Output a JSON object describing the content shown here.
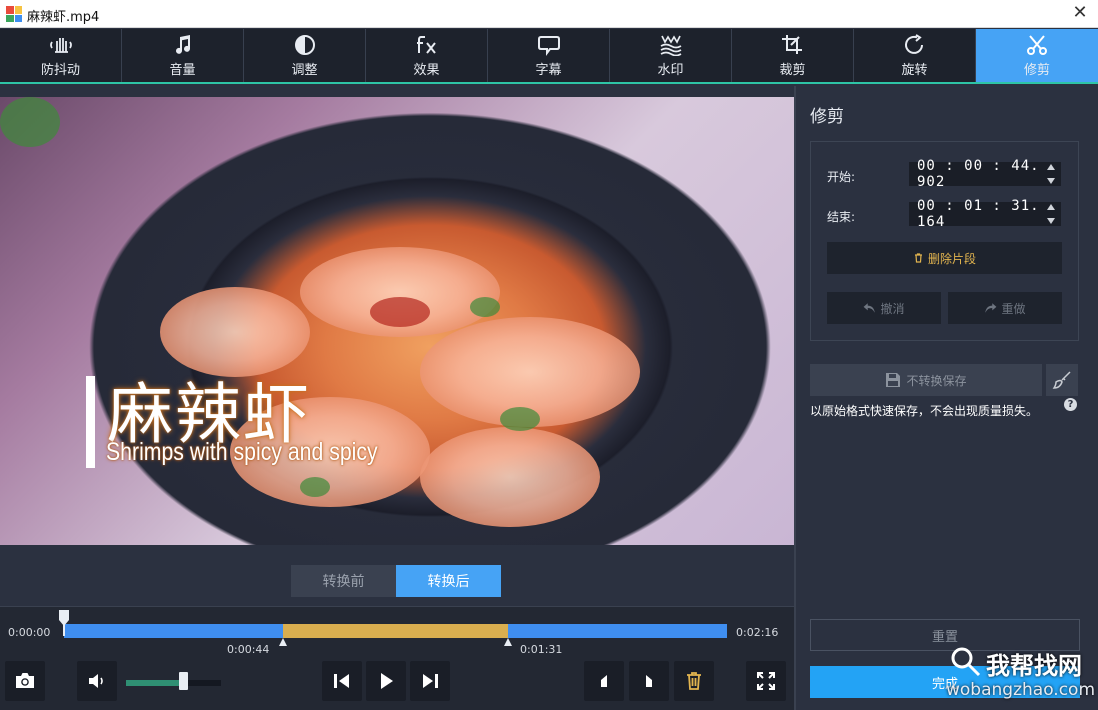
{
  "window": {
    "title": "麻辣虾.mp4",
    "close_glyph": "✕"
  },
  "toolbar": {
    "tools": [
      {
        "label": "防抖动",
        "icon": "hand-stabilize-icon"
      },
      {
        "label": "音量",
        "icon": "music-note-icon"
      },
      {
        "label": "调整",
        "icon": "contrast-icon"
      },
      {
        "label": "效果",
        "icon": "fx-icon"
      },
      {
        "label": "字幕",
        "icon": "speech-bubble-icon"
      },
      {
        "label": "水印",
        "icon": "watermark-icon"
      },
      {
        "label": "裁剪",
        "icon": "crop-icon"
      },
      {
        "label": "旋转",
        "icon": "rotate-icon"
      },
      {
        "label": "修剪",
        "icon": "scissors-icon"
      }
    ],
    "active_index": 8
  },
  "preview": {
    "caption_cn": "麻辣虾",
    "caption_en": "Shrimps with spicy and spicy"
  },
  "compare": {
    "before_label": "转换前",
    "after_label": "转换后",
    "selected": "after"
  },
  "timeline": {
    "start_time": "0:00:00",
    "end_time": "0:02:16",
    "selection_start_label": "0:00:44",
    "selection_end_label": "0:01:31",
    "duration_seconds": 136,
    "selection_start_seconds": 44.902,
    "selection_end_seconds": 91.164,
    "playhead_seconds": 0
  },
  "controls": {
    "volume_level": 0.6
  },
  "trim_panel": {
    "title": "修剪",
    "start_label": "开始:",
    "start_value": "00 : 00 : 44. 902",
    "end_label": "结束:",
    "end_value": "00 : 01 : 31. 164",
    "delete_label": "删除片段",
    "undo_label": "撤消",
    "redo_label": "重做",
    "save_label": "不转换保存",
    "save_desc": "以原始格式快速保存，不会出现质量损失。",
    "help_glyph": "?",
    "reset_label": "重置",
    "done_label": "完成"
  },
  "watermark": {
    "top_text": "我帮找网",
    "bottom_text": "wobangzhao.com"
  },
  "colors": {
    "accent": "#46a3f5",
    "selection": "#d9ae4f",
    "track": "#3f8ef0",
    "toolbar_line": "#2ec4a6"
  }
}
